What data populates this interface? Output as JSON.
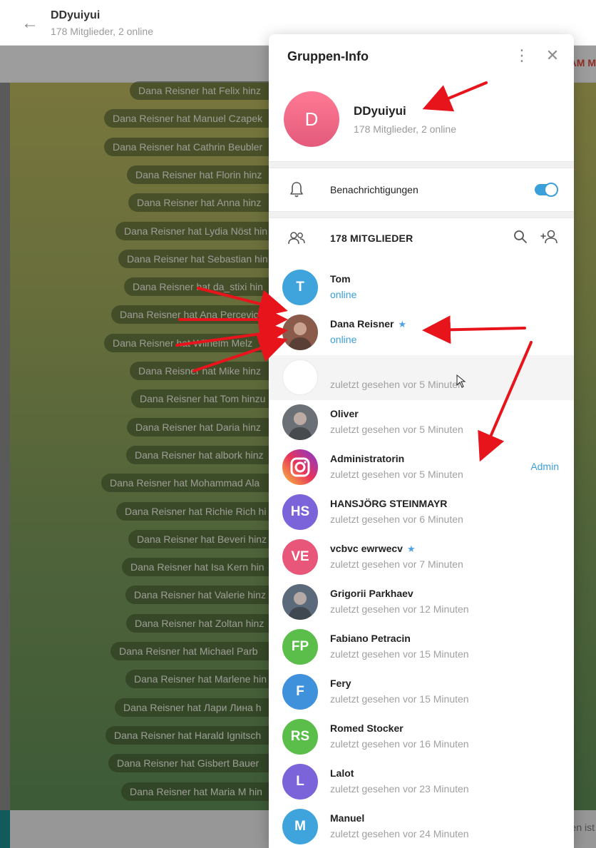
{
  "chat": {
    "title": "DDyuiyui",
    "subtitle": "178 Mitglieder, 2 online",
    "pinned_fragment": "AM M",
    "footer_fragment": "en ist",
    "service_messages": [
      "Dana Reisner hat Felix hinz",
      "Dana Reisner hat Manuel Czapek",
      "Dana Reisner hat Cathrin Beubler",
      "Dana Reisner hat Florin hinz",
      "Dana Reisner hat Anna hinz",
      "Dana Reisner hat Lydia Nöst hin",
      "Dana Reisner hat Sebastian hin",
      "Dana Reisner hat da_stixi hin",
      "Dana Reisner hat Ana Percevic",
      "Dana Reisner hat Wilhelm Melz",
      "Dana Reisner hat Mike hinz",
      "Dana Reisner hat Tom hinzu",
      "Dana Reisner hat Daria hinz",
      "Dana Reisner hat albork hinz",
      "Dana Reisner hat Mohammad Ala",
      "Dana Reisner hat Richie Rich hi",
      "Dana Reisner hat Beveri hinz",
      "Dana Reisner hat Isa Kern hin",
      "Dana Reisner hat Valerie hinz",
      "Dana Reisner hat Zoltan hinz",
      "Dana Reisner hat Michael Parb",
      "Dana Reisner hat Marlene hin",
      "Dana Reisner hat Лари Лина h",
      "Dana Reisner hat Harald Ignitsch",
      "Dana Reisner hat Gisbert Bauer",
      "Dana Reisner hat Maria M hin"
    ]
  },
  "modal": {
    "title": "Gruppen-Info",
    "group": {
      "initial": "D",
      "name": "DDyuiyui",
      "subtitle": "178 Mitglieder, 2 online"
    },
    "notifications_label": "Benachrichtigungen",
    "notifications_enabled": true,
    "members_label": "178 MITGLIEDER",
    "members": [
      {
        "name": "Tom",
        "status": "online",
        "initials": "T",
        "color": "#3fa3dc",
        "online": true,
        "star": false,
        "badge": ""
      },
      {
        "name": "Dana Reisner",
        "status": "online",
        "initials": "",
        "color": "#8a5a4a",
        "online": true,
        "star": true,
        "badge": ""
      },
      {
        "name": "",
        "status": "zuletzt gesehen vor 5 Minuten",
        "initials": "",
        "color": "#ffffff",
        "online": false,
        "star": false,
        "badge": ""
      },
      {
        "name": "Oliver",
        "status": "zuletzt gesehen vor 5 Minuten",
        "initials": "",
        "color": "#6b6f76",
        "online": false,
        "star": false,
        "badge": ""
      },
      {
        "name": "Administratorin",
        "status": "zuletzt gesehen vor 5 Minuten",
        "initials": "",
        "color": "#d6246e",
        "online": false,
        "star": false,
        "badge": "Admin"
      },
      {
        "name": "HANSJÖRG STEINMAYR",
        "status": "zuletzt gesehen vor 6 Minuten",
        "initials": "HS",
        "color": "#7b63d9",
        "online": false,
        "star": false,
        "badge": ""
      },
      {
        "name": "vcbvc ewrwecv",
        "status": "zuletzt gesehen vor 7 Minuten",
        "initials": "VE",
        "color": "#e8577a",
        "online": false,
        "star": true,
        "badge": ""
      },
      {
        "name": "Grigorii Parkhaev",
        "status": "zuletzt gesehen vor 12 Minuten",
        "initials": "",
        "color": "#5a6a7a",
        "online": false,
        "star": false,
        "badge": ""
      },
      {
        "name": "Fabiano Petracin",
        "status": "zuletzt gesehen vor 15 Minuten",
        "initials": "FP",
        "color": "#5cbe4a",
        "online": false,
        "star": false,
        "badge": ""
      },
      {
        "name": "Fery",
        "status": "zuletzt gesehen vor 15 Minuten",
        "initials": "F",
        "color": "#3f91dc",
        "online": false,
        "star": false,
        "badge": ""
      },
      {
        "name": "Romed Stocker",
        "status": "zuletzt gesehen vor 16 Minuten",
        "initials": "RS",
        "color": "#5cbe4a",
        "online": false,
        "star": false,
        "badge": ""
      },
      {
        "name": "Lalot",
        "status": "zuletzt gesehen vor 23 Minuten",
        "initials": "L",
        "color": "#7b63d9",
        "online": false,
        "star": false,
        "badge": ""
      },
      {
        "name": "Manuel",
        "status": "zuletzt gesehen vor 24 Minuten",
        "initials": "M",
        "color": "#3fa3dc",
        "online": false,
        "star": false,
        "badge": ""
      }
    ]
  }
}
